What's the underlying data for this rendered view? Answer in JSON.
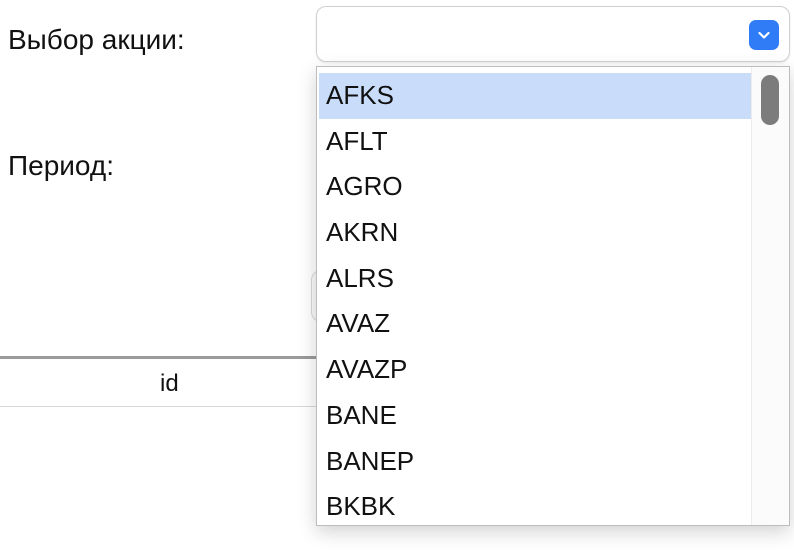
{
  "labels": {
    "stock_selection": "Выбор акции:",
    "period": "Период:"
  },
  "select": {
    "value": "",
    "arrow_icon": "chevron-down-icon",
    "accent_color": "#2f7cf6"
  },
  "table": {
    "header_id": "id"
  },
  "dropdown": {
    "selected_index": 0,
    "items": [
      {
        "label": "AFKS"
      },
      {
        "label": "AFLT"
      },
      {
        "label": "AGRO"
      },
      {
        "label": "AKRN"
      },
      {
        "label": "ALRS"
      },
      {
        "label": "AVAZ"
      },
      {
        "label": "AVAZP"
      },
      {
        "label": "BANE"
      },
      {
        "label": "BANEP"
      },
      {
        "label": "BKBK"
      }
    ],
    "selection_color": "#c9ddfb"
  }
}
